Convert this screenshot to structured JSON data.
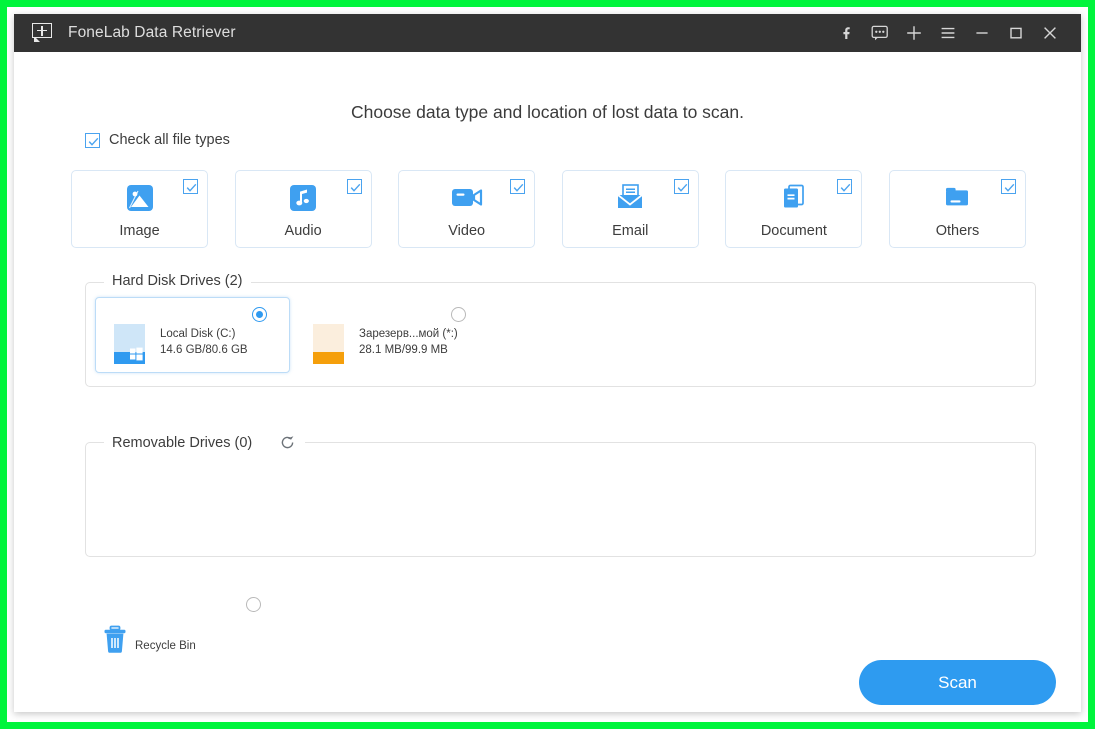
{
  "window": {
    "title": "FoneLab Data Retriever",
    "logo_icon": "speech-bubble-plus-icon",
    "controls": [
      {
        "name": "facebook-icon",
        "label": "f"
      },
      {
        "name": "feedback-bubble-icon",
        "label": ""
      },
      {
        "name": "plus-icon",
        "label": "+"
      },
      {
        "name": "menu-icon",
        "label": "☰"
      },
      {
        "name": "minimize-icon",
        "label": "–"
      },
      {
        "name": "maximize-icon",
        "label": "□"
      },
      {
        "name": "close-icon",
        "label": "✕"
      }
    ]
  },
  "heading": "Choose data type and location of lost data to scan.",
  "check_all": {
    "label": "Check all file types",
    "checked": true
  },
  "file_types": [
    {
      "label": "Image",
      "icon": "image-icon",
      "checked": true
    },
    {
      "label": "Audio",
      "icon": "audio-icon",
      "checked": true
    },
    {
      "label": "Video",
      "icon": "video-icon",
      "checked": true
    },
    {
      "label": "Email",
      "icon": "email-icon",
      "checked": true
    },
    {
      "label": "Document",
      "icon": "document-icon",
      "checked": true
    },
    {
      "label": "Others",
      "icon": "folder-icon",
      "checked": true
    }
  ],
  "hard_disk_drives": {
    "legend": "Hard Disk Drives (2)",
    "drives": [
      {
        "name": "Local Disk (C:)",
        "size": "14.6 GB/80.6 GB",
        "selected": true,
        "bar_color": "#2f9af0",
        "icon": "windows-drive-icon"
      },
      {
        "name": "Зарезерв...мой (*:)",
        "size": "28.1 MB/99.9 MB",
        "selected": false,
        "bar_color": "#f59f0b",
        "icon": "drive-icon"
      }
    ]
  },
  "removable_drives": {
    "legend": "Removable Drives (0)",
    "refresh_icon": "refresh-icon",
    "drives": []
  },
  "recycle_bin": {
    "label": "Recycle Bin",
    "icon": "trash-icon",
    "selected": false
  },
  "scan_button": {
    "label": "Scan"
  },
  "colors": {
    "accent": "#2e9bf0",
    "titlebar": "#333333",
    "recording_border": "#00f53c",
    "orange": "#f59f0b"
  }
}
